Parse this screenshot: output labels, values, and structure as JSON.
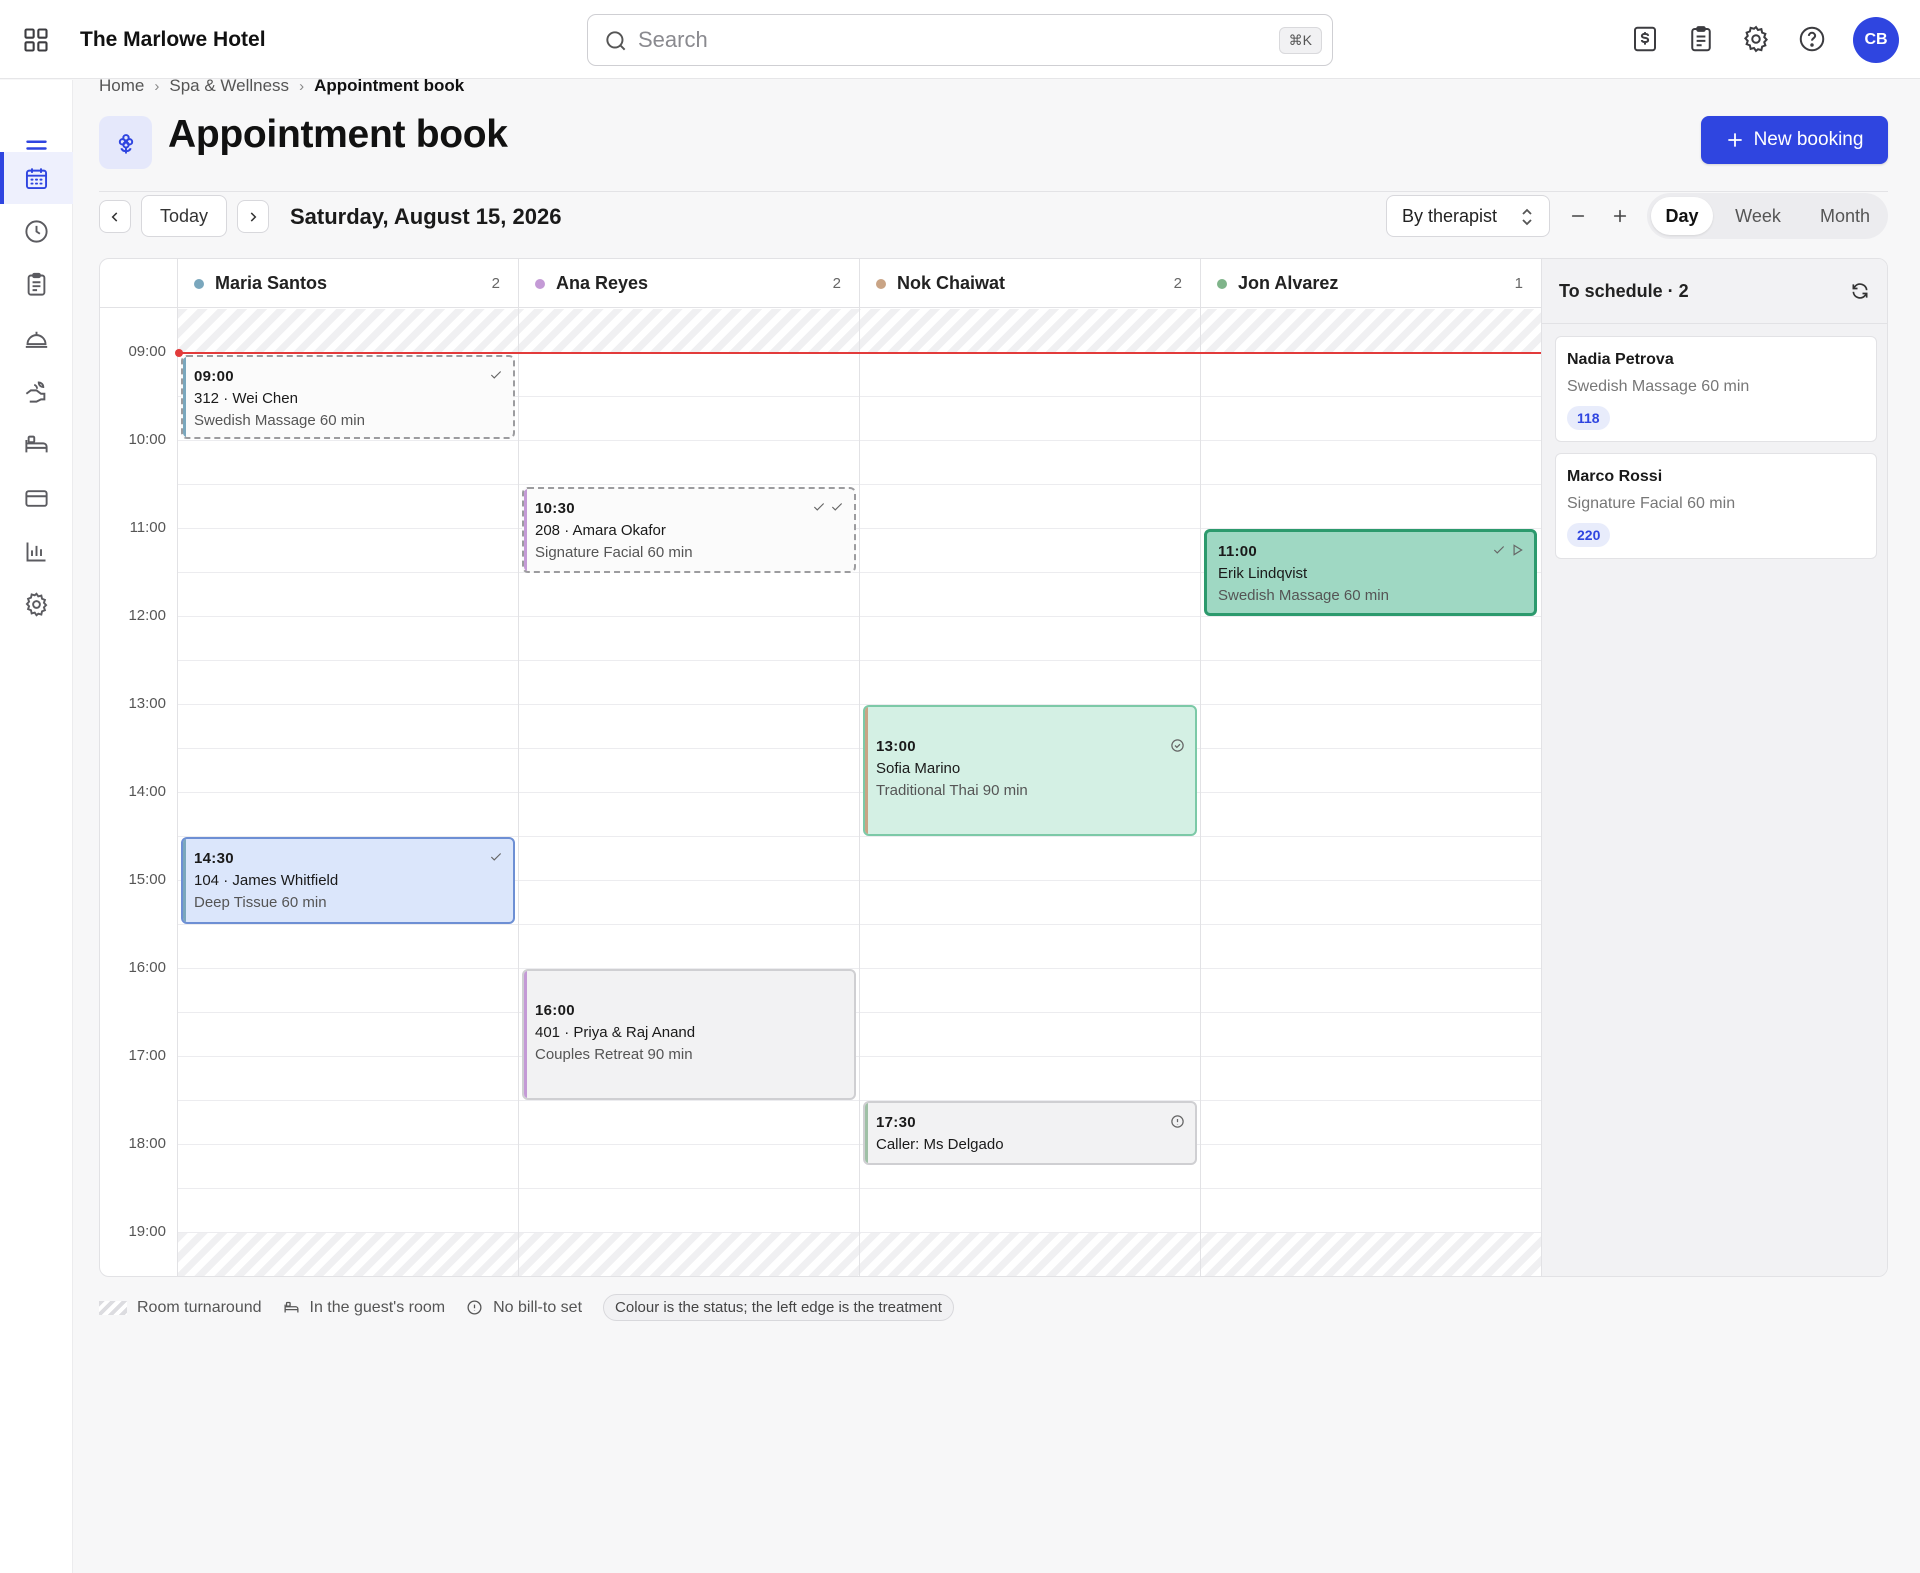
{
  "app": {
    "hotel_name": "The Marlowe Hotel",
    "user_initials": "CB",
    "accent": "#2f45e0"
  },
  "search": {
    "placeholder": "Search",
    "shortcut": "⌘K"
  },
  "topbar_icons": [
    "billing-icon",
    "clipboard-icon",
    "settings-icon",
    "help-icon"
  ],
  "sidebar": {
    "items": [
      "menu-icon",
      "calendar-icon",
      "clock-icon",
      "clipboard-icon",
      "service-bell-icon",
      "spa-hand-icon",
      "bed-icon",
      "card-icon",
      "chart-icon",
      "settings-icon"
    ],
    "active": "calendar-icon"
  },
  "breadcrumb": {
    "home": "Home",
    "section": "Spa & Wellness",
    "current": "Appointment book"
  },
  "page": {
    "title": "Appointment book",
    "new_booking": "New booking"
  },
  "controls": {
    "today": "Today",
    "date": "Saturday, August 15, 2026",
    "group_by": "By therapist",
    "views": [
      "Day",
      "Week",
      "Month"
    ],
    "active_view": "Day"
  },
  "times": [
    "09:00",
    "10:00",
    "11:00",
    "12:00",
    "13:00",
    "14:00",
    "15:00",
    "16:00",
    "17:00",
    "18:00",
    "19:00"
  ],
  "therapists": [
    {
      "name": "Maria Santos",
      "count": "2",
      "color": "#7aa7bd"
    },
    {
      "name": "Ana Reyes",
      "count": "2",
      "color": "#c49ad6"
    },
    {
      "name": "Nok Chaiwat",
      "count": "2",
      "color": "#c9a485"
    },
    {
      "name": "Jon Alvarez",
      "count": "1",
      "color": "#7fb48a"
    }
  ],
  "appointments": [
    {
      "time": "09:00",
      "guest": "312 · Wei Chen",
      "service": "Swedish Massage 60 min",
      "status": "tentative"
    },
    {
      "time": "10:30",
      "guest": "208 · Amara Okafor",
      "service": "Signature Facial 60 min",
      "status": "tentative"
    },
    {
      "time": "11:00",
      "guest": "Erik Lindqvist",
      "service": "Swedish Massage 60 min",
      "status": "in-progress"
    },
    {
      "time": "13:00",
      "guest": "Sofia Marino",
      "service": "Traditional Thai 90 min",
      "status": "booked"
    },
    {
      "time": "14:30",
      "guest": "104 · James Whitfield",
      "service": "Deep Tissue 60 min",
      "status": "confirmed"
    },
    {
      "time": "16:00",
      "guest": "401 · Priya & Raj Anand",
      "service": "Couples Retreat 90 min",
      "status": "booked"
    },
    {
      "time": "17:30",
      "guest": "Caller: Ms Delgado",
      "service": "",
      "status": "booked"
    }
  ],
  "to_schedule": {
    "title": "To schedule · 2",
    "items": [
      {
        "name": "Nadia Petrova",
        "service": "Swedish Massage 60 min",
        "room": "118"
      },
      {
        "name": "Marco Rossi",
        "service": "Signature Facial 60 min",
        "room": "220"
      }
    ]
  },
  "legend": {
    "turnaround": "Room turnaround",
    "in_room": "In the guest's room",
    "no_bill": "No bill-to set",
    "note": "Colour is the status; the left edge is the treatment"
  }
}
